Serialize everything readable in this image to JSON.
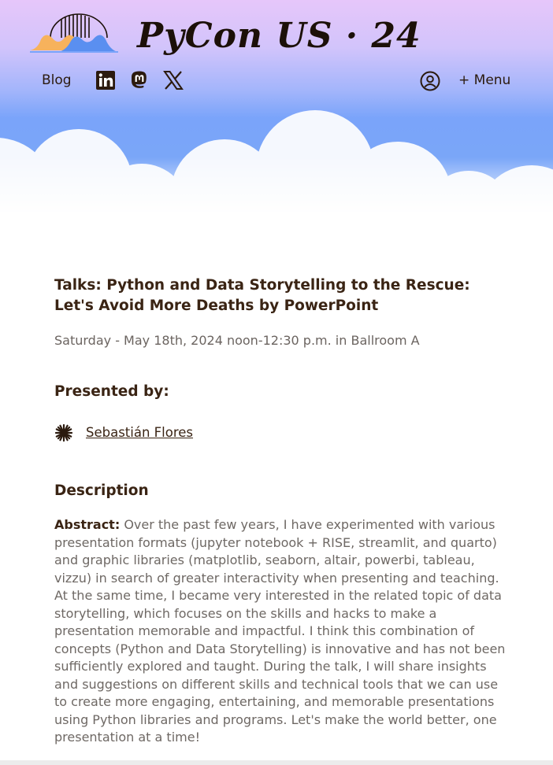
{
  "header": {
    "wordmark": "PyCon US · 24",
    "nav": {
      "blog_label": "Blog",
      "social_icons": [
        "linkedin-icon",
        "mastodon-icon",
        "x-icon"
      ],
      "account_icon": "user-circle-icon",
      "menu_label": "+ Menu"
    }
  },
  "talk": {
    "title": "Talks: Python and Data Storytelling to the Rescue: Let's Avoid More Deaths by PowerPoint",
    "schedule": "Saturday - May 18th, 2024 noon-12:30 p.m. in Ballroom A",
    "presented_heading": "Presented by:",
    "speaker": "Sebastián Flores",
    "description_heading": "Description",
    "abstract_label": "Abstract:",
    "abstract_text": " Over the past few years, I have experimented with various presentation formats (jupyter notebook + RISE, streamlit, and quarto) and graphic libraries (matplotlib, seaborn, altair, powerbi, tableau, vizzu) in search of greater interactivity when presenting and teaching. At the same time, I became very interested in the related topic of data storytelling, which focuses on the skills and hacks to make a presentation memorable and impactful. I think this combination of concepts (Python and Data Storytelling) is innovative and has not been sufficiently explored and taught. During the talk, I will share insights and suggestions on different skills and technical tools that we can use to create more engaging, entertaining, and memorable presentations using Python libraries and programs. Let's make the world better, one presentation at a time!"
  },
  "colors": {
    "text_dark": "#3a2414",
    "text_muted": "#6e6864",
    "sky_top": "#e6c6fa",
    "sky_blue": "#7aa4fa",
    "logo_orange": "#f7b25c",
    "logo_blue": "#5a8ff0"
  }
}
